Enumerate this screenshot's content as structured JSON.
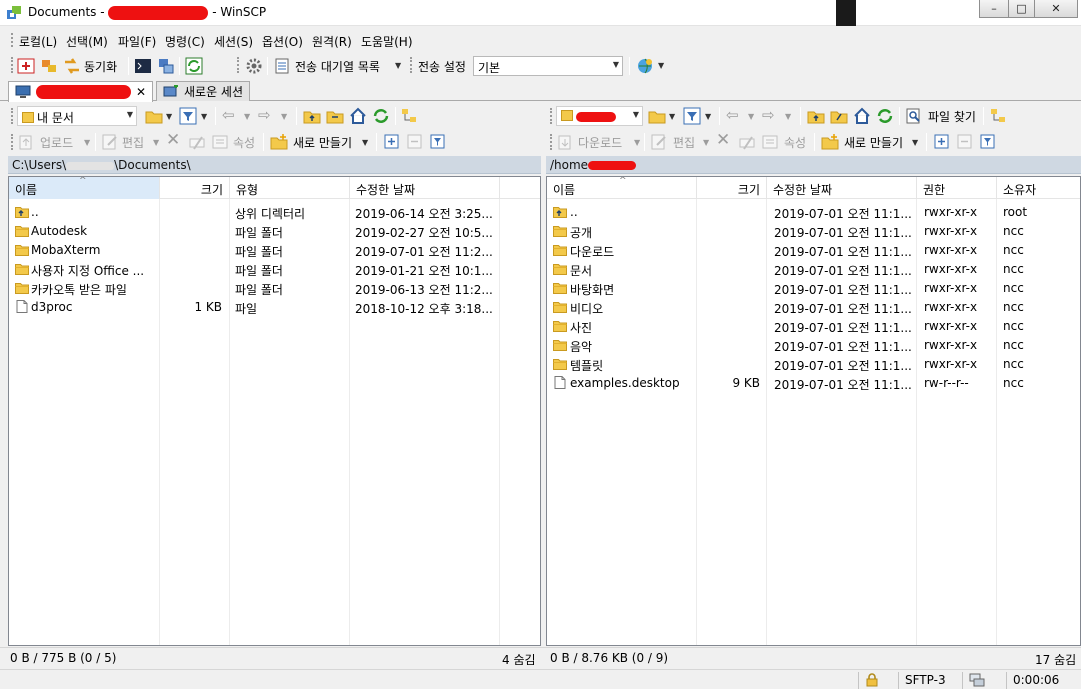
{
  "window": {
    "title_prefix": "Documents - ",
    "title_suffix": " - WinSCP",
    "controls": [
      "–",
      "□",
      "✕"
    ]
  },
  "menu": [
    "로컬(L)",
    "선택(M)",
    "파일(F)",
    "명령(C)",
    "세션(S)",
    "옵션(O)",
    "원격(R)",
    "도움말(H)"
  ],
  "toolbar": {
    "sync_label": "동기화",
    "queue_label": "전송 대기열 목록",
    "transfer_settings_label": "전송 설정",
    "transfer_preset": "기본"
  },
  "tabs": {
    "new_session_label": "새로운 세션"
  },
  "local": {
    "location": "내 문서",
    "actions": {
      "upload": "업로드",
      "edit": "편집",
      "properties": "속성",
      "new": "새로 만들기"
    },
    "path": "C:\\Users\\",
    "path_tail": "\\Documents\\",
    "columns": [
      "이름",
      "크기",
      "유형",
      "수정한 날짜"
    ],
    "rows": [
      {
        "name": "..",
        "size": "",
        "type": "상위 디렉터리",
        "modified": "2019-06-14  오전 3:25...",
        "kind": "up"
      },
      {
        "name": "Autodesk",
        "size": "",
        "type": "파일 폴더",
        "modified": "2019-02-27  오전 10:5...",
        "kind": "folder"
      },
      {
        "name": "MobaXterm",
        "size": "",
        "type": "파일 폴더",
        "modified": "2019-07-01  오전 11:2...",
        "kind": "folder"
      },
      {
        "name": "사용자 지정 Office ...",
        "size": "",
        "type": "파일 폴더",
        "modified": "2019-01-21  오전 10:1...",
        "kind": "folder"
      },
      {
        "name": "카카오톡 받은 파일",
        "size": "",
        "type": "파일 폴더",
        "modified": "2019-06-13  오전 11:2...",
        "kind": "folder"
      },
      {
        "name": "d3proc",
        "size": "1 KB",
        "type": "파일",
        "modified": "2018-10-12  오후 3:18...",
        "kind": "file"
      }
    ],
    "status_left": "0 B / 775 B (0 / 5)",
    "status_right": "4 숨김"
  },
  "remote": {
    "actions": {
      "download": "다운로드",
      "edit": "편집",
      "properties": "속성",
      "new": "새로 만들기",
      "find": "파일 찾기"
    },
    "path": "/home",
    "columns": [
      "이름",
      "크기",
      "수정한 날짜",
      "권한",
      "소유자"
    ],
    "rows": [
      {
        "name": "..",
        "size": "",
        "modified": "2019-07-01 오전 11:1...",
        "perm": "rwxr-xr-x",
        "owner": "root",
        "kind": "up"
      },
      {
        "name": "공개",
        "size": "",
        "modified": "2019-07-01 오전 11:1...",
        "perm": "rwxr-xr-x",
        "owner": "ncc",
        "kind": "folder"
      },
      {
        "name": "다운로드",
        "size": "",
        "modified": "2019-07-01 오전 11:1...",
        "perm": "rwxr-xr-x",
        "owner": "ncc",
        "kind": "folder"
      },
      {
        "name": "문서",
        "size": "",
        "modified": "2019-07-01 오전 11:1...",
        "perm": "rwxr-xr-x",
        "owner": "ncc",
        "kind": "folder"
      },
      {
        "name": "바탕화면",
        "size": "",
        "modified": "2019-07-01 오전 11:1...",
        "perm": "rwxr-xr-x",
        "owner": "ncc",
        "kind": "folder"
      },
      {
        "name": "비디오",
        "size": "",
        "modified": "2019-07-01 오전 11:1...",
        "perm": "rwxr-xr-x",
        "owner": "ncc",
        "kind": "folder"
      },
      {
        "name": "사진",
        "size": "",
        "modified": "2019-07-01 오전 11:1...",
        "perm": "rwxr-xr-x",
        "owner": "ncc",
        "kind": "folder"
      },
      {
        "name": "음악",
        "size": "",
        "modified": "2019-07-01 오전 11:1...",
        "perm": "rwxr-xr-x",
        "owner": "ncc",
        "kind": "folder"
      },
      {
        "name": "템플릿",
        "size": "",
        "modified": "2019-07-01 오전 11:1...",
        "perm": "rwxr-xr-x",
        "owner": "ncc",
        "kind": "folder"
      },
      {
        "name": "examples.desktop",
        "size": "9 KB",
        "modified": "2019-07-01 오전 11:1...",
        "perm": "rw-r--r--",
        "owner": "ncc",
        "kind": "file"
      }
    ],
    "status_left": "0 B / 8.76 KB (0 / 9)",
    "status_right": "17 숨김"
  },
  "statusbar": {
    "protocol": "SFTP-3",
    "elapsed": "0:00:06"
  },
  "colors": {
    "folder": "#f3c94a",
    "path_bar": "#cfd8e2",
    "selected_header": "#dbeaf9",
    "redaction": "#ee1111"
  }
}
